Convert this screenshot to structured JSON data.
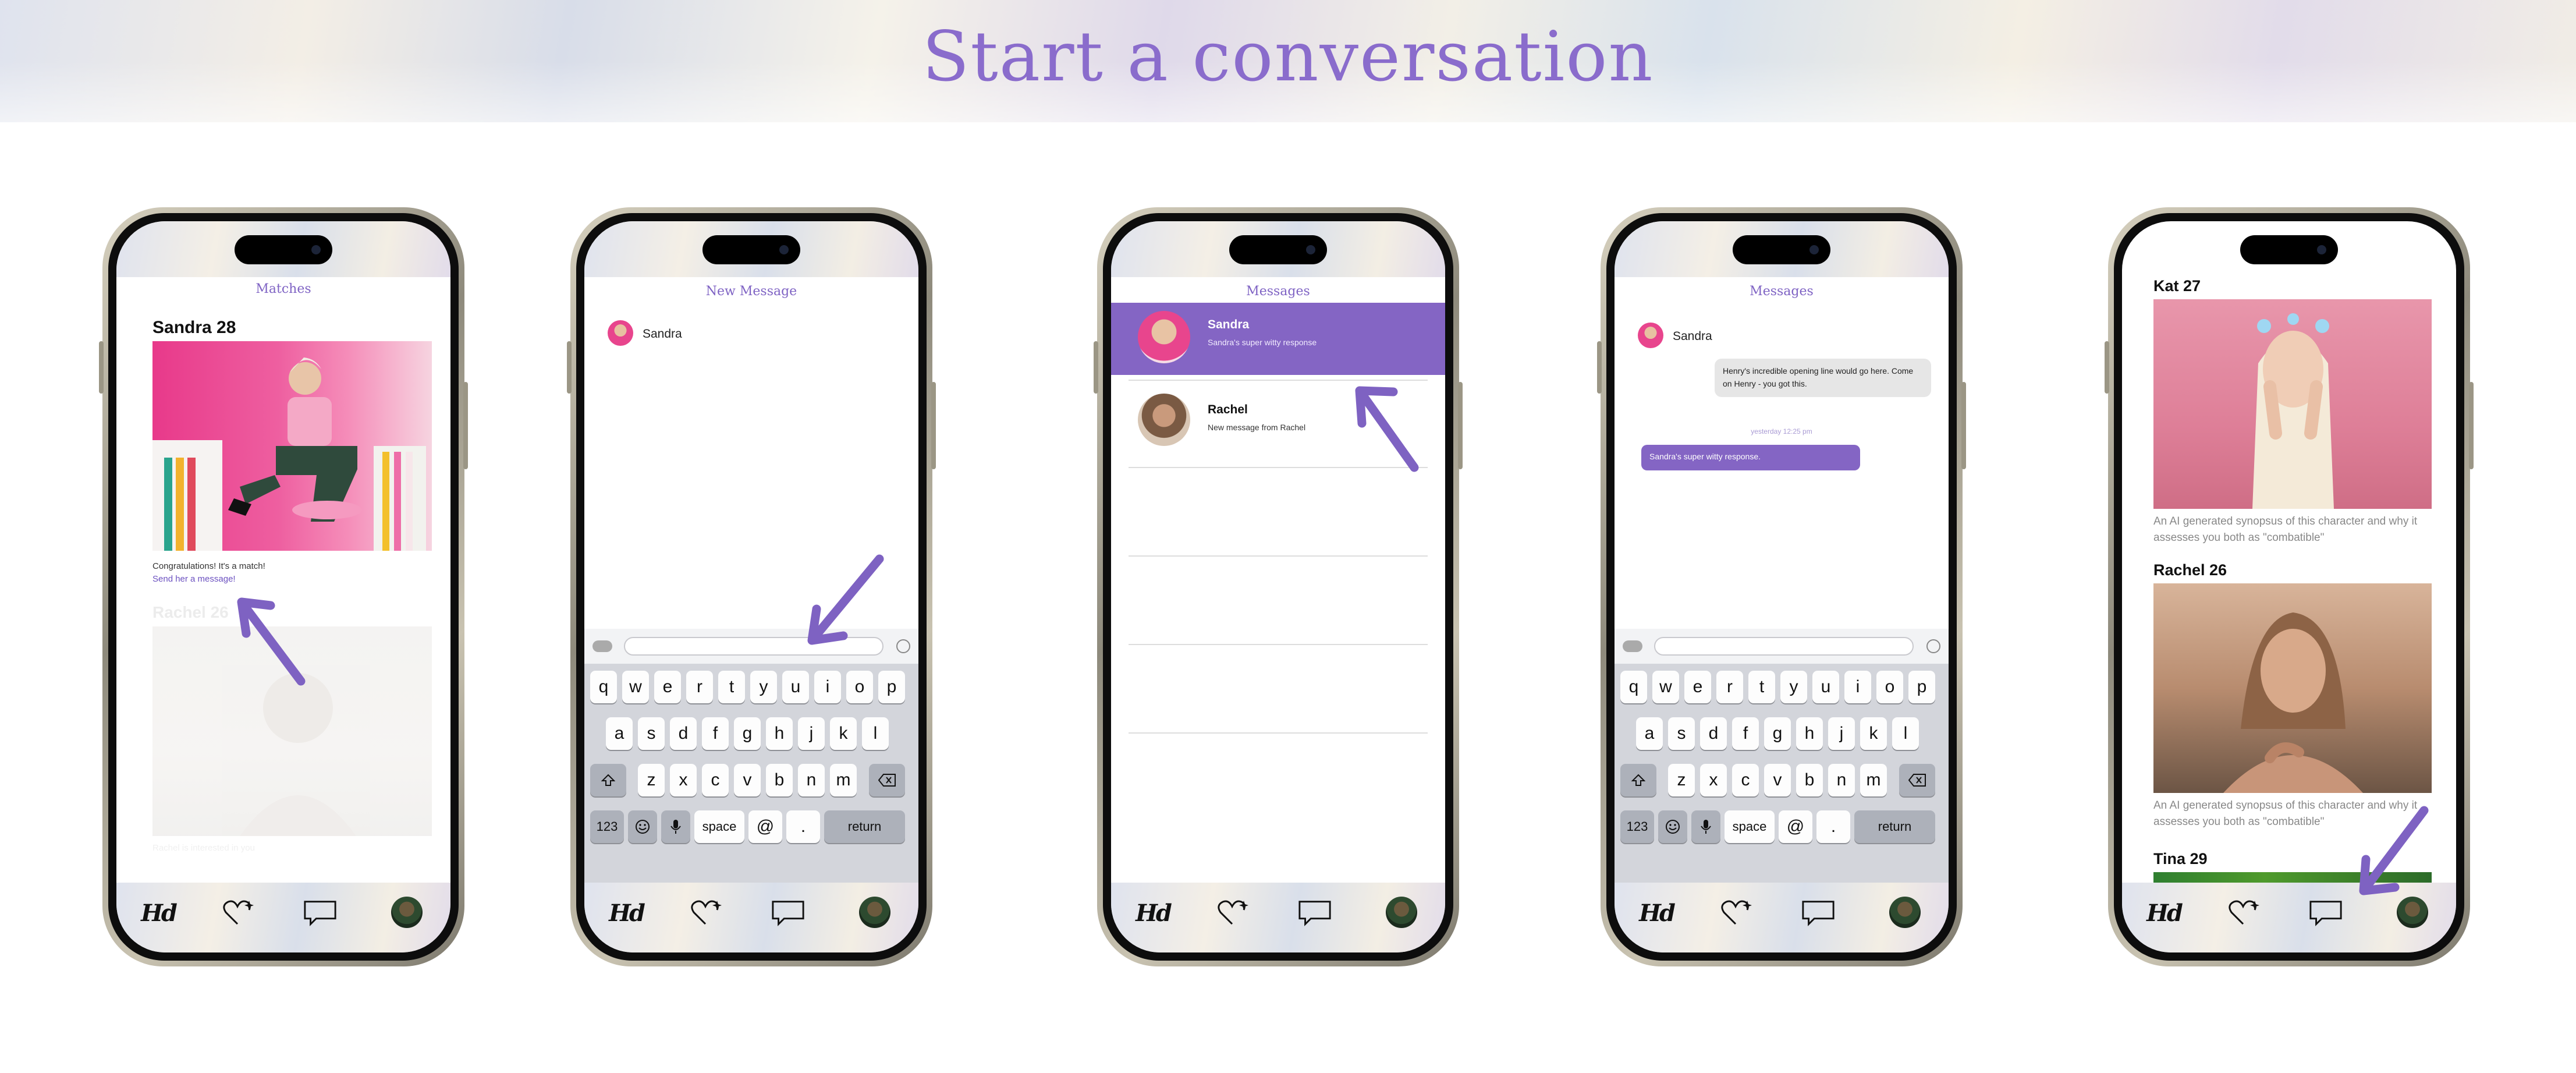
{
  "title": "Start a conversation",
  "colors": {
    "accent": "#8a6ccc",
    "selected_row": "#8465c4",
    "arrow": "#7e62c2"
  },
  "nav": {
    "logo": "Hd",
    "icons": [
      "hd-logo-icon",
      "heart-sparkle-icon",
      "chat-bubble-icon",
      "profile-avatar"
    ]
  },
  "phone1": {
    "screen_title": "Matches",
    "match_name": "Sandra 28",
    "congrats": "Congratulations! It's a match!",
    "cta": "Send her a message!",
    "faded_name": "Rachel 26",
    "faded_caption": "Rachel is interested in you"
  },
  "phone2": {
    "screen_title": "New Message",
    "recipient": "Sandra"
  },
  "phone3": {
    "screen_title": "Messages",
    "conversations": [
      {
        "name": "Sandra",
        "preview": "Sandra's super witty response"
      },
      {
        "name": "Rachel",
        "preview": "New message from Rachel"
      }
    ]
  },
  "phone4": {
    "screen_title": "Messages",
    "recipient": "Sandra",
    "sent": "Henry's incredible opening line would go here. Come on Henry - you got this.",
    "timestamp": "yesterday 12:25 pm",
    "received": "Sandra's super witty response."
  },
  "phone5": {
    "profiles": [
      {
        "name": "Kat 27",
        "synopsis": "An AI generated synopsus of this character and why it assesses you both as \"combatible\""
      },
      {
        "name": "Rachel 26",
        "synopsis": "An AI generated synopsus of this character and why it assesses you both as \"combatible\""
      },
      {
        "name": "Tina 29"
      }
    ]
  },
  "keyboard": {
    "row1": [
      "q",
      "w",
      "e",
      "r",
      "t",
      "y",
      "u",
      "i",
      "o",
      "p"
    ],
    "row2": [
      "a",
      "s",
      "d",
      "f",
      "g",
      "h",
      "j",
      "k",
      "l"
    ],
    "row3": [
      "z",
      "x",
      "c",
      "v",
      "b",
      "n",
      "m"
    ],
    "numbers": "123",
    "space": "space",
    "at": "@",
    "dot": ".",
    "return": "return"
  }
}
